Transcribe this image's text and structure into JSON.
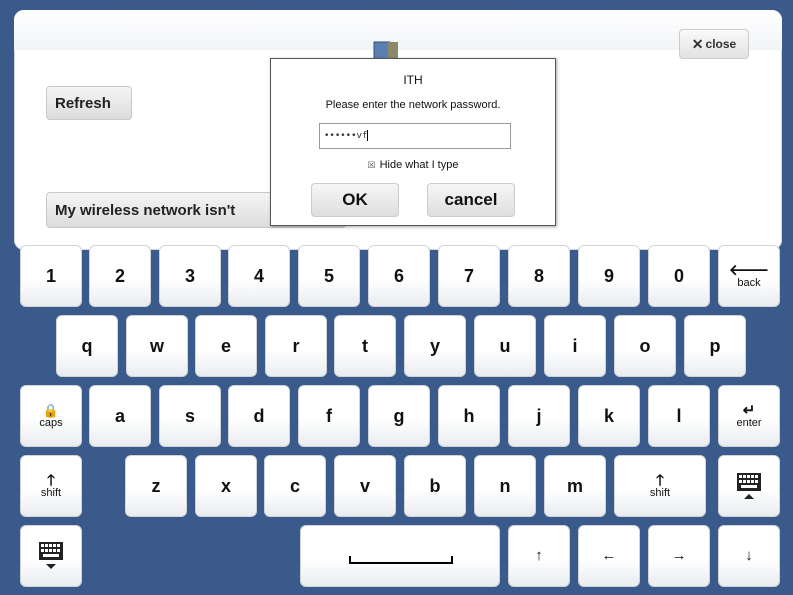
{
  "panel": {
    "refresh_label": "Refresh",
    "no_network_label": "My wireless network isn't",
    "close_label": "close",
    "close_icon": "close-x-icon"
  },
  "dialog": {
    "title": "ITH",
    "prompt": "Please enter the network password.",
    "password_value": "••••••vf",
    "hide_label": "Hide what I type",
    "hide_checked": true,
    "ok_label": "OK",
    "cancel_label": "cancel"
  },
  "keyboard": {
    "row1": [
      "1",
      "2",
      "3",
      "4",
      "5",
      "6",
      "7",
      "8",
      "9",
      "0"
    ],
    "back_label": "back",
    "row2": [
      "q",
      "w",
      "e",
      "r",
      "t",
      "y",
      "u",
      "i",
      "o",
      "p"
    ],
    "caps_label": "caps",
    "row3": [
      "a",
      "s",
      "d",
      "f",
      "g",
      "h",
      "j",
      "k",
      "l"
    ],
    "enter_label": "enter",
    "shift_label": "shift",
    "row4": [
      "z",
      "x",
      "c",
      "v",
      "b",
      "n",
      "m"
    ],
    "arrows": [
      "↑",
      "←",
      "→",
      "↓"
    ]
  },
  "colors": {
    "background": "#3a5a8c",
    "panel": "#ffffff"
  }
}
